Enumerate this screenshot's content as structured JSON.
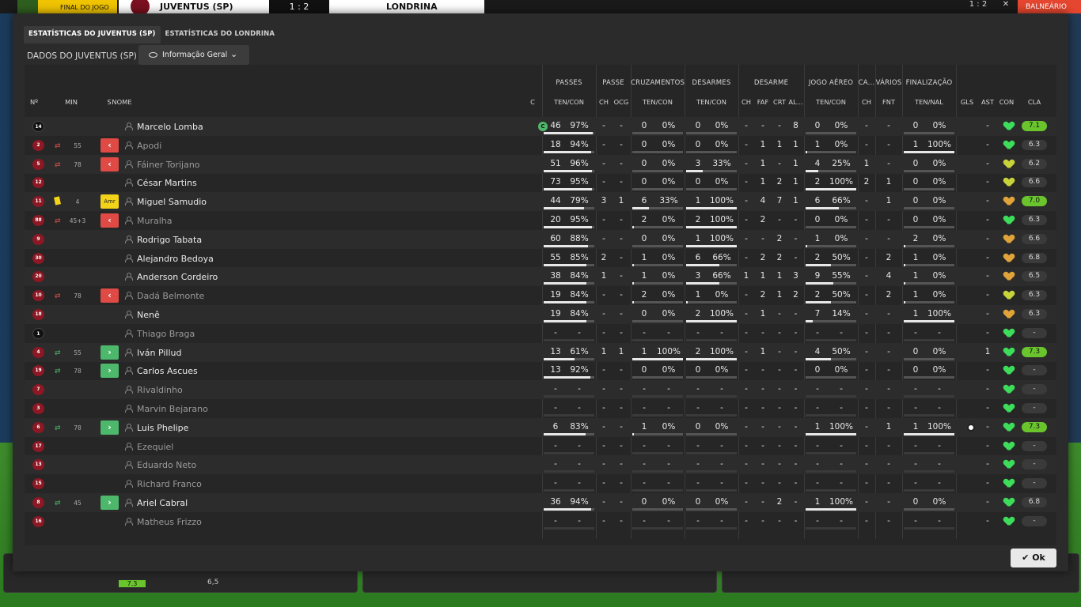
{
  "topbar": {
    "final_label": "FINAL DO JOGO",
    "home_team": "JUVENTUS (SP)",
    "score": "1 : 2",
    "away_team": "LONDRINA",
    "right_score": "1 : 2",
    "close": "✕",
    "side_label": "BALNEÁRIO"
  },
  "tabs": [
    "ESTATÍSTICAS DO JUVENTUS (SP)",
    "ESTATÍSTICAS DO LONDRINA"
  ],
  "subtitle": "DADOS DO JUVENTUS (SP)",
  "dropdown": {
    "label": "Informação Geral",
    "icon": "eye-icon"
  },
  "ok_label": "Ok",
  "bottom": {
    "rating": "7.3",
    "value": "6,5"
  },
  "groups": [
    "PASSES",
    "PASSE",
    "CRUZAMENTOS",
    "DESARMES",
    "DESARME",
    "JOGO AÉREO",
    "CA...",
    "VÁRIOS",
    "FINALIZAÇÃO"
  ],
  "columns": {
    "num": "Nº",
    "min": "MIN",
    "s": "S",
    "name": "NOME",
    "c": "C",
    "passes": "TEN/CON",
    "passe_ch": "CH",
    "passe_ocg": "OCG",
    "cruz": "TEN/CON",
    "desarmes": "TEN/CON",
    "d_ch": "CH",
    "d_faf": "FAF",
    "d_crt": "CRT",
    "d_al": "AL...",
    "aereo": "TEN/CON",
    "ca_ch": "CH",
    "varios_fnt": "FNT",
    "final": "TEN/NAL",
    "gls": "GLS",
    "ast": "AST",
    "con": "CON",
    "cla": "CLA"
  },
  "colors": {
    "heart_green": "#3ddc5a",
    "heart_yellow": "#c8d23a",
    "heart_orange": "#e0a33a",
    "rating_good": "#6ac52c",
    "sub_out": "#df4a44",
    "sub_in": "#4db86b"
  },
  "players": [
    {
      "num": "14",
      "gk": true,
      "sub": "",
      "min": "",
      "s": "",
      "name": "Marcelo Lomba",
      "dim": false,
      "cap": "C",
      "pt": "46",
      "pp": "97%",
      "ch": "-",
      "ocg": "-",
      "ct": "0",
      "cp": "0%",
      "dt": "0",
      "dp": "0%",
      "dch": "-",
      "faf": "-",
      "crt": "-",
      "al": "8",
      "at": "0",
      "ap": "0%",
      "cach": "-",
      "fnt": "-",
      "ft": "0",
      "fp": "0%",
      "gls": "",
      "ast": "-",
      "con": "green",
      "cla": "7.1",
      "good": true
    },
    {
      "num": "2",
      "gk": false,
      "sub": "out",
      "min": "55",
      "s": "out",
      "name": "Apodi",
      "dim": true,
      "cap": "",
      "pt": "18",
      "pp": "94%",
      "ch": "-",
      "ocg": "-",
      "ct": "0",
      "cp": "0%",
      "dt": "0",
      "dp": "0%",
      "dch": "-",
      "faf": "1",
      "crt": "1",
      "al": "1",
      "at": "1",
      "ap": "0%",
      "cach": "-",
      "fnt": "-",
      "ft": "1",
      "fp": "100%",
      "gls": "",
      "ast": "-",
      "con": "green",
      "cla": "6.3",
      "good": false
    },
    {
      "num": "5",
      "gk": false,
      "sub": "out",
      "min": "78",
      "s": "out",
      "name": "Fáiner Torijano",
      "dim": true,
      "cap": "",
      "pt": "51",
      "pp": "96%",
      "ch": "-",
      "ocg": "-",
      "ct": "0",
      "cp": "0%",
      "dt": "3",
      "dp": "33%",
      "dch": "-",
      "faf": "1",
      "crt": "-",
      "al": "1",
      "at": "4",
      "ap": "25%",
      "cach": "1",
      "fnt": "-",
      "ft": "0",
      "fp": "0%",
      "gls": "",
      "ast": "-",
      "con": "yellow",
      "cla": "6.2",
      "good": false
    },
    {
      "num": "12",
      "gk": false,
      "sub": "",
      "min": "",
      "s": "",
      "name": "César Martins",
      "dim": false,
      "cap": "",
      "pt": "73",
      "pp": "95%",
      "ch": "-",
      "ocg": "-",
      "ct": "0",
      "cp": "0%",
      "dt": "0",
      "dp": "0%",
      "dch": "-",
      "faf": "1",
      "crt": "2",
      "al": "1",
      "at": "2",
      "ap": "100%",
      "cach": "2",
      "fnt": "1",
      "ft": "0",
      "fp": "0%",
      "gls": "",
      "ast": "-",
      "con": "yellow",
      "cla": "6.6",
      "good": false
    },
    {
      "num": "11",
      "gk": false,
      "sub": "yellow",
      "min": "4",
      "s": "amr",
      "name": "Miguel Samudio",
      "dim": false,
      "cap": "",
      "pt": "44",
      "pp": "79%",
      "ch": "3",
      "ocg": "1",
      "ct": "6",
      "cp": "33%",
      "dt": "1",
      "dp": "100%",
      "dch": "-",
      "faf": "4",
      "crt": "7",
      "al": "1",
      "at": "6",
      "ap": "66%",
      "cach": "-",
      "fnt": "1",
      "ft": "0",
      "fp": "0%",
      "gls": "",
      "ast": "-",
      "con": "orange",
      "cla": "7.0",
      "good": true
    },
    {
      "num": "88",
      "gk": false,
      "sub": "out",
      "min": "45+3",
      "s": "out",
      "name": "Muralha",
      "dim": true,
      "cap": "",
      "pt": "20",
      "pp": "95%",
      "ch": "-",
      "ocg": "-",
      "ct": "2",
      "cp": "0%",
      "dt": "2",
      "dp": "100%",
      "dch": "-",
      "faf": "2",
      "crt": "-",
      "al": "-",
      "at": "0",
      "ap": "0%",
      "cach": "-",
      "fnt": "-",
      "ft": "0",
      "fp": "0%",
      "gls": "",
      "ast": "-",
      "con": "green",
      "cla": "6.3",
      "good": false
    },
    {
      "num": "9",
      "gk": false,
      "sub": "",
      "min": "",
      "s": "",
      "name": "Rodrigo Tabata",
      "dim": false,
      "cap": "",
      "pt": "60",
      "pp": "88%",
      "ch": "-",
      "ocg": "-",
      "ct": "0",
      "cp": "0%",
      "dt": "1",
      "dp": "100%",
      "dch": "-",
      "faf": "-",
      "crt": "2",
      "al": "-",
      "at": "1",
      "ap": "0%",
      "cach": "-",
      "fnt": "-",
      "ft": "2",
      "fp": "0%",
      "gls": "",
      "ast": "-",
      "con": "orange",
      "cla": "6.6",
      "good": false
    },
    {
      "num": "30",
      "gk": false,
      "sub": "",
      "min": "",
      "s": "",
      "name": "Alejandro Bedoya",
      "dim": false,
      "cap": "",
      "pt": "55",
      "pp": "85%",
      "ch": "2",
      "ocg": "-",
      "ct": "1",
      "cp": "0%",
      "dt": "6",
      "dp": "66%",
      "dch": "-",
      "faf": "2",
      "crt": "2",
      "al": "-",
      "at": "2",
      "ap": "50%",
      "cach": "-",
      "fnt": "2",
      "ft": "1",
      "fp": "0%",
      "gls": "",
      "ast": "-",
      "con": "orange",
      "cla": "6.8",
      "good": false
    },
    {
      "num": "20",
      "gk": false,
      "sub": "",
      "min": "",
      "s": "",
      "name": "Anderson Cordeiro",
      "dim": false,
      "cap": "",
      "pt": "38",
      "pp": "84%",
      "ch": "1",
      "ocg": "-",
      "ct": "1",
      "cp": "0%",
      "dt": "3",
      "dp": "66%",
      "dch": "1",
      "faf": "1",
      "crt": "1",
      "al": "3",
      "at": "9",
      "ap": "55%",
      "cach": "-",
      "fnt": "4",
      "ft": "1",
      "fp": "0%",
      "gls": "",
      "ast": "-",
      "con": "orange",
      "cla": "6.5",
      "good": false
    },
    {
      "num": "10",
      "gk": false,
      "sub": "out",
      "min": "78",
      "s": "out",
      "name": "Dadá Belmonte",
      "dim": true,
      "cap": "",
      "pt": "19",
      "pp": "84%",
      "ch": "-",
      "ocg": "-",
      "ct": "2",
      "cp": "0%",
      "dt": "1",
      "dp": "0%",
      "dch": "-",
      "faf": "2",
      "crt": "1",
      "al": "2",
      "at": "2",
      "ap": "50%",
      "cach": "-",
      "fnt": "2",
      "ft": "1",
      "fp": "0%",
      "gls": "",
      "ast": "-",
      "con": "yellow",
      "cla": "6.3",
      "good": false
    },
    {
      "num": "18",
      "gk": false,
      "sub": "",
      "min": "",
      "s": "",
      "name": "Nenê",
      "dim": false,
      "cap": "",
      "pt": "19",
      "pp": "84%",
      "ch": "-",
      "ocg": "-",
      "ct": "0",
      "cp": "0%",
      "dt": "2",
      "dp": "100%",
      "dch": "-",
      "faf": "1",
      "crt": "-",
      "al": "-",
      "at": "7",
      "ap": "14%",
      "cach": "-",
      "fnt": "-",
      "ft": "1",
      "fp": "100%",
      "gls": "",
      "ast": "-",
      "con": "orange",
      "cla": "6.3",
      "good": false
    },
    {
      "num": "1",
      "gk": true,
      "sub": "",
      "min": "",
      "s": "",
      "name": "Thiago Braga",
      "dim": true,
      "cap": "",
      "pt": "-",
      "pp": "-",
      "ch": "-",
      "ocg": "-",
      "ct": "-",
      "cp": "-",
      "dt": "-",
      "dp": "-",
      "dch": "-",
      "faf": "-",
      "crt": "-",
      "al": "-",
      "at": "-",
      "ap": "-",
      "cach": "-",
      "fnt": "-",
      "ft": "-",
      "fp": "-",
      "gls": "",
      "ast": "-",
      "con": "green",
      "cla": "-",
      "good": false
    },
    {
      "num": "4",
      "gk": false,
      "sub": "in",
      "min": "55",
      "s": "in",
      "name": "Iván Pillud",
      "dim": false,
      "cap": "",
      "pt": "13",
      "pp": "61%",
      "ch": "1",
      "ocg": "1",
      "ct": "1",
      "cp": "100%",
      "dt": "2",
      "dp": "100%",
      "dch": "-",
      "faf": "1",
      "crt": "-",
      "al": "-",
      "at": "4",
      "ap": "50%",
      "cach": "-",
      "fnt": "-",
      "ft": "0",
      "fp": "0%",
      "gls": "",
      "ast": "1",
      "con": "green",
      "cla": "7.3",
      "good": true
    },
    {
      "num": "19",
      "gk": false,
      "sub": "in",
      "min": "78",
      "s": "in",
      "name": "Carlos Ascues",
      "dim": false,
      "cap": "",
      "pt": "13",
      "pp": "92%",
      "ch": "-",
      "ocg": "-",
      "ct": "0",
      "cp": "0%",
      "dt": "0",
      "dp": "0%",
      "dch": "-",
      "faf": "-",
      "crt": "-",
      "al": "-",
      "at": "0",
      "ap": "0%",
      "cach": "-",
      "fnt": "-",
      "ft": "0",
      "fp": "0%",
      "gls": "",
      "ast": "-",
      "con": "green",
      "cla": "-",
      "good": false
    },
    {
      "num": "7",
      "gk": false,
      "sub": "",
      "min": "",
      "s": "",
      "name": "Rivaldinho",
      "dim": true,
      "cap": "",
      "pt": "-",
      "pp": "-",
      "ch": "-",
      "ocg": "-",
      "ct": "-",
      "cp": "-",
      "dt": "-",
      "dp": "-",
      "dch": "-",
      "faf": "-",
      "crt": "-",
      "al": "-",
      "at": "-",
      "ap": "-",
      "cach": "-",
      "fnt": "-",
      "ft": "-",
      "fp": "-",
      "gls": "",
      "ast": "-",
      "con": "green",
      "cla": "-",
      "good": false
    },
    {
      "num": "3",
      "gk": false,
      "sub": "",
      "min": "",
      "s": "",
      "name": "Marvin Bejarano",
      "dim": true,
      "cap": "",
      "pt": "-",
      "pp": "-",
      "ch": "-",
      "ocg": "-",
      "ct": "-",
      "cp": "-",
      "dt": "-",
      "dp": "-",
      "dch": "-",
      "faf": "-",
      "crt": "-",
      "al": "-",
      "at": "-",
      "ap": "-",
      "cach": "-",
      "fnt": "-",
      "ft": "-",
      "fp": "-",
      "gls": "",
      "ast": "-",
      "con": "green",
      "cla": "-",
      "good": false
    },
    {
      "num": "6",
      "gk": false,
      "sub": "in",
      "min": "78",
      "s": "in",
      "name": "Luis Phelipe",
      "dim": false,
      "cap": "",
      "pt": "6",
      "pp": "83%",
      "ch": "-",
      "ocg": "-",
      "ct": "1",
      "cp": "0%",
      "dt": "0",
      "dp": "0%",
      "dch": "-",
      "faf": "-",
      "crt": "-",
      "al": "-",
      "at": "1",
      "ap": "100%",
      "cach": "-",
      "fnt": "1",
      "ft": "1",
      "fp": "100%",
      "gls": "ball",
      "ast": "-",
      "con": "green",
      "cla": "7.3",
      "good": true
    },
    {
      "num": "17",
      "gk": false,
      "sub": "",
      "min": "",
      "s": "",
      "name": "Ezequiel",
      "dim": true,
      "cap": "",
      "pt": "-",
      "pp": "-",
      "ch": "-",
      "ocg": "-",
      "ct": "-",
      "cp": "-",
      "dt": "-",
      "dp": "-",
      "dch": "-",
      "faf": "-",
      "crt": "-",
      "al": "-",
      "at": "-",
      "ap": "-",
      "cach": "-",
      "fnt": "-",
      "ft": "-",
      "fp": "-",
      "gls": "",
      "ast": "-",
      "con": "green",
      "cla": "-",
      "good": false
    },
    {
      "num": "13",
      "gk": false,
      "sub": "",
      "min": "",
      "s": "",
      "name": "Eduardo Neto",
      "dim": true,
      "cap": "",
      "pt": "-",
      "pp": "-",
      "ch": "-",
      "ocg": "-",
      "ct": "-",
      "cp": "-",
      "dt": "-",
      "dp": "-",
      "dch": "-",
      "faf": "-",
      "crt": "-",
      "al": "-",
      "at": "-",
      "ap": "-",
      "cach": "-",
      "fnt": "-",
      "ft": "-",
      "fp": "-",
      "gls": "",
      "ast": "-",
      "con": "green",
      "cla": "-",
      "good": false
    },
    {
      "num": "15",
      "gk": false,
      "sub": "",
      "min": "",
      "s": "",
      "name": "Richard Franco",
      "dim": true,
      "cap": "",
      "pt": "-",
      "pp": "-",
      "ch": "-",
      "ocg": "-",
      "ct": "-",
      "cp": "-",
      "dt": "-",
      "dp": "-",
      "dch": "-",
      "faf": "-",
      "crt": "-",
      "al": "-",
      "at": "-",
      "ap": "-",
      "cach": "-",
      "fnt": "-",
      "ft": "-",
      "fp": "-",
      "gls": "",
      "ast": "-",
      "con": "green",
      "cla": "-",
      "good": false
    },
    {
      "num": "8",
      "gk": false,
      "sub": "in",
      "min": "45",
      "s": "in",
      "name": "Ariel Cabral",
      "dim": false,
      "cap": "",
      "pt": "36",
      "pp": "94%",
      "ch": "-",
      "ocg": "-",
      "ct": "0",
      "cp": "0%",
      "dt": "0",
      "dp": "0%",
      "dch": "-",
      "faf": "-",
      "crt": "2",
      "al": "-",
      "at": "1",
      "ap": "100%",
      "cach": "-",
      "fnt": "-",
      "ft": "0",
      "fp": "0%",
      "gls": "",
      "ast": "-",
      "con": "green",
      "cla": "6.8",
      "good": false
    },
    {
      "num": "16",
      "gk": false,
      "sub": "",
      "min": "",
      "s": "",
      "name": "Matheus Frizzo",
      "dim": true,
      "cap": "",
      "pt": "-",
      "pp": "-",
      "ch": "-",
      "ocg": "-",
      "ct": "-",
      "cp": "-",
      "dt": "-",
      "dp": "-",
      "dch": "-",
      "faf": "-",
      "crt": "-",
      "al": "-",
      "at": "-",
      "ap": "-",
      "cach": "-",
      "fnt": "-",
      "ft": "-",
      "fp": "-",
      "gls": "",
      "ast": "-",
      "con": "green",
      "cla": "-",
      "good": false
    }
  ]
}
